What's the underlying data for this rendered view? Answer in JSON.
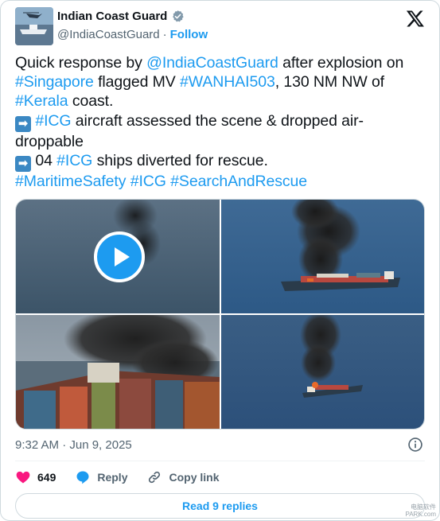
{
  "author": {
    "name": "Indian Coast Guard",
    "handle": "@IndiaCoastGuard",
    "separator": "·",
    "follow_label": "Follow",
    "verified_icon": "verified-gray-badge",
    "platform_icon": "x-logo-icon"
  },
  "tweet": {
    "line1_a": "Quick response by ",
    "mention": "@IndiaCoastGuard",
    "line1_b": " after explosion on",
    "tag_singapore": "#Singapore",
    "line2_a": " flagged MV ",
    "tag_wanhai": "#WANHAI503",
    "line2_b": ", 130 NM NW of",
    "tag_kerala": "#Kerala",
    "line3_b": " coast.",
    "tag_icg1": "#ICG",
    "line4_b": " aircraft assessed the scene & dropped air-droppable",
    "line5_a": " 04 ",
    "tag_icg2": "#ICG",
    "line5_b": " ships diverted for rescue.",
    "tag_maritime": "#MaritimeSafety",
    "tag_icg3": "#ICG",
    "tag_sar": "#SearchAndRescue",
    "arrow_glyph": "➡"
  },
  "media": {
    "count": 4,
    "first_is_video": true,
    "play_icon": "play-icon"
  },
  "meta": {
    "timestamp": "9:32 AM · Jun 9, 2025",
    "info_icon": "info-icon"
  },
  "actions": {
    "likes": "649",
    "reply_label": "Reply",
    "copy_label": "Copy link"
  },
  "replies_button": "Read 9 replies",
  "watermark": "电脑软件\nPARK.com",
  "colors": {
    "accent": "#1d9bf0",
    "like": "#f91880",
    "muted": "#536471",
    "text": "#0f1419"
  }
}
